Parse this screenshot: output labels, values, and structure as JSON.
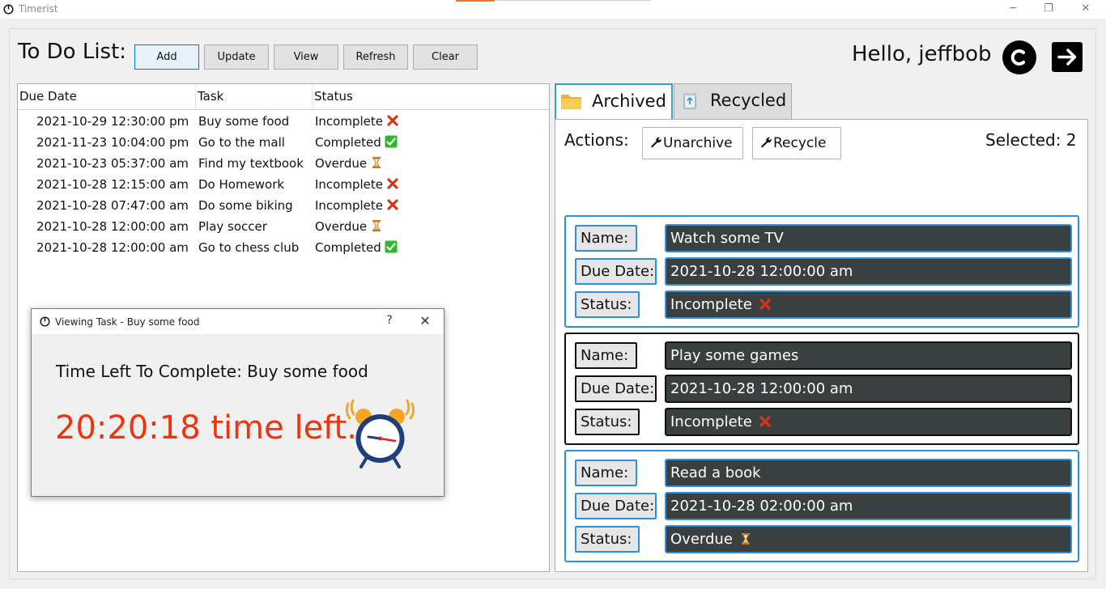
{
  "window": {
    "title": "Timerist",
    "controls": [
      "─",
      "❐",
      "✕"
    ]
  },
  "toolbar": {
    "heading": "To Do List:",
    "buttons": [
      "Add",
      "Update",
      "View",
      "Refresh",
      "Clear"
    ],
    "greeting": "Hello, jeffbob"
  },
  "table": {
    "columns": [
      "Due Date",
      "Task",
      "Status"
    ],
    "rows": [
      {
        "due": "2021-10-29 12:30:00 pm",
        "task": "Buy some food",
        "status": "Incomplete",
        "icon": "cross-icon"
      },
      {
        "due": "2021-11-23 10:04:00 pm",
        "task": "Go to the mall",
        "status": "Completed",
        "icon": "check-icon"
      },
      {
        "due": "2021-10-23 05:37:00 am",
        "task": "Find my textbook",
        "status": "Overdue",
        "icon": "hourglass-icon"
      },
      {
        "due": "2021-10-28 12:15:00 am",
        "task": "Do Homework",
        "status": "Incomplete",
        "icon": "cross-icon"
      },
      {
        "due": "2021-10-28 07:47:00 am",
        "task": "Do some biking",
        "status": "Incomplete",
        "icon": "cross-icon"
      },
      {
        "due": "2021-10-28 12:00:00 am",
        "task": "Play soccer",
        "status": "Overdue",
        "icon": "hourglass-icon"
      },
      {
        "due": "2021-10-28 12:00:00 am",
        "task": "Go to chess club",
        "status": "Completed",
        "icon": "check-icon"
      }
    ]
  },
  "dialog": {
    "title": "Viewing Task - Buy some food",
    "help": "?",
    "close": "✕",
    "heading": "Time Left To Complete: Buy some food",
    "time_left": "20:20:18 time left."
  },
  "tabs": [
    {
      "label": "Archived",
      "active": true
    },
    {
      "label": "Recycled",
      "active": false
    }
  ],
  "actions": {
    "label": "Actions:",
    "unarchive": "Unarchive",
    "recycle": "Recycle",
    "selected": "Selected: 2"
  },
  "cards": [
    {
      "name_label": "Name:",
      "name": "Watch some TV",
      "due_label": "Due Date:",
      "due": "2021-10-28 12:00:00 am",
      "status_label": "Status:",
      "status": "Incomplete",
      "icon": "cross-icon",
      "selected": true
    },
    {
      "name_label": "Name:",
      "name": "Play some games",
      "due_label": "Due Date:",
      "due": "2021-10-28 12:00:00 am",
      "status_label": "Status:",
      "status": "Incomplete",
      "icon": "cross-icon",
      "selected": false
    },
    {
      "name_label": "Name:",
      "name": "Read a book",
      "due_label": "Due Date:",
      "due": "2021-10-28 02:00:00 am",
      "status_label": "Status:",
      "status": "Overdue",
      "icon": "hourglass-icon",
      "selected": true
    }
  ],
  "colors": {
    "accent_blue": "#2f8fd8",
    "time_red": "#f0330c",
    "card_field_bg": "#3a3f3f"
  }
}
